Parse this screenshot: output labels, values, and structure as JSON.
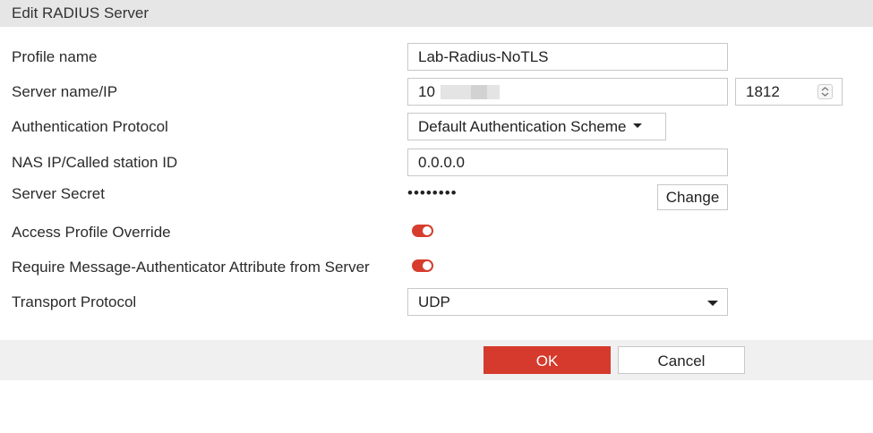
{
  "title": "Edit RADIUS Server",
  "form": {
    "profile_name_label": "Profile name",
    "profile_name_value": "Lab-Radius-NoTLS",
    "server_label": "Server name/IP",
    "server_value": "10",
    "port_value": "1812",
    "auth_protocol_label": "Authentication Protocol",
    "auth_protocol_value": "Default Authentication Scheme",
    "nas_label": "NAS IP/Called station ID",
    "nas_value": "0.0.0.0",
    "secret_label": "Server Secret",
    "secret_value": "••••••••",
    "change_label": "Change",
    "access_override_label": "Access Profile Override",
    "access_override_on": true,
    "require_auth_label": "Require Message-Authenticator Attribute from Server",
    "require_auth_on": true,
    "transport_label": "Transport Protocol",
    "transport_value": "UDP"
  },
  "footer": {
    "ok_label": "OK",
    "cancel_label": "Cancel"
  },
  "colors": {
    "accent": "#d53a2c",
    "titlebar": "#e6e6e6",
    "footer": "#f0f0f0"
  },
  "icons": {
    "toggle": "toggle-on-icon",
    "spinner": "up-down-spinner-icon",
    "caret": "caret-down-icon"
  }
}
